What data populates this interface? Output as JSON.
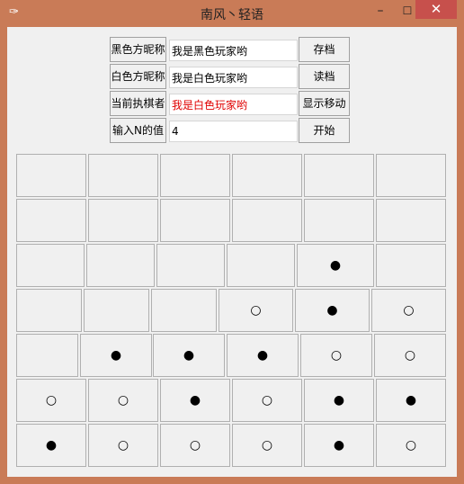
{
  "window": {
    "title": "南风丶轻语",
    "app_icon": "feather-icon",
    "minimize_glyph": "–",
    "maximize_glyph": "☐",
    "close_glyph": "✕"
  },
  "form": {
    "black_nick_label": "黑色方昵称",
    "black_nick_value": "我是黑色玩家哟",
    "white_nick_label": "白色方昵称",
    "white_nick_value": "我是白色玩家哟",
    "current_player_label": "当前执棋者",
    "current_player_value": "我是白色玩家哟",
    "current_player_color": "#e00000",
    "n_label": "输入N的值",
    "n_value": "4"
  },
  "buttons": {
    "save": "存档",
    "load": "读档",
    "show_moves": "显示移动",
    "start": "开始"
  },
  "board": {
    "rows": [
      [
        "",
        "",
        "",
        "",
        "",
        ""
      ],
      [
        "",
        "",
        "",
        "",
        "",
        ""
      ],
      [
        "",
        "",
        "",
        "",
        "●",
        ""
      ],
      [
        "",
        "",
        "",
        "○",
        "●",
        "○"
      ],
      [
        "",
        "●",
        "●",
        "●",
        "○",
        "○"
      ],
      [
        "○",
        "○",
        "●",
        "○",
        "●",
        "●"
      ],
      [
        "●",
        "○",
        "○",
        "○",
        "●",
        "○"
      ]
    ]
  }
}
